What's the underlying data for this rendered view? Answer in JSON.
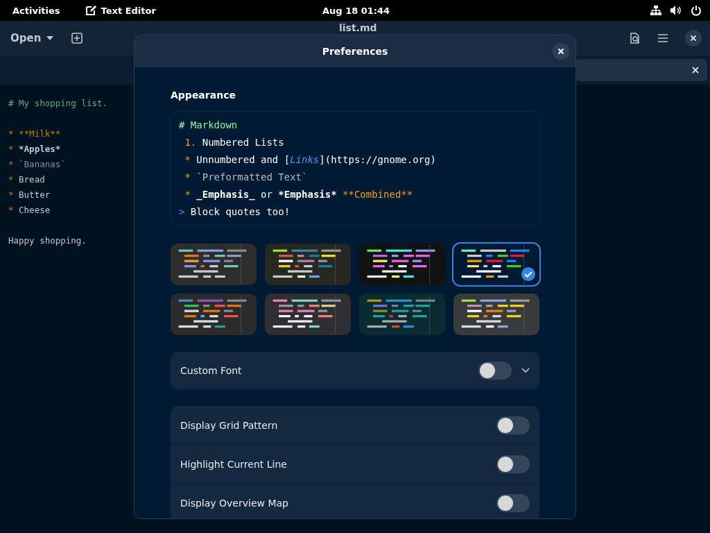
{
  "top_bar": {
    "activities": "Activities",
    "app_name": "Text Editor",
    "clock": "Aug 18  01:44"
  },
  "header": {
    "open_label": "Open",
    "title": "list.md"
  },
  "editor": {
    "paragraphs": [
      {
        "lines": [
          {
            "segments": [
              {
                "kind": "heading",
                "text": "# My shopping list."
              }
            ]
          }
        ]
      },
      {
        "lines": [
          {
            "segments": [
              {
                "kind": "marker",
                "text": "* "
              },
              {
                "kind": "strong",
                "text": "**Milk**"
              }
            ]
          },
          {
            "segments": [
              {
                "kind": "marker",
                "text": "* "
              },
              {
                "kind": "bold",
                "text": "*Apples*"
              }
            ]
          },
          {
            "segments": [
              {
                "kind": "marker",
                "text": "* "
              },
              {
                "kind": "code",
                "text": "`Bananas`"
              }
            ]
          },
          {
            "segments": [
              {
                "kind": "marker",
                "text": "* "
              },
              {
                "kind": "plain",
                "text": "Bread"
              }
            ]
          },
          {
            "segments": [
              {
                "kind": "marker",
                "text": "* "
              },
              {
                "kind": "plain",
                "text": "Butter"
              }
            ]
          },
          {
            "segments": [
              {
                "kind": "marker",
                "text": "* "
              },
              {
                "kind": "plain",
                "text": "Cheese"
              }
            ]
          }
        ]
      },
      {
        "lines": [
          {
            "segments": [
              {
                "kind": "plain",
                "text": "Happy shopping."
              }
            ]
          }
        ]
      }
    ]
  },
  "dialog": {
    "title": "Preferences",
    "section": "Appearance",
    "preview": [
      {
        "segments": [
          {
            "kind": "heading",
            "text": "# Markdown"
          }
        ]
      },
      {
        "segments": [
          {
            "kind": "marker",
            "text": " 1. "
          },
          {
            "kind": "plain",
            "text": "Numbered Lists"
          }
        ]
      },
      {
        "segments": [
          {
            "kind": "marker",
            "text": " * "
          },
          {
            "kind": "plain",
            "text": "Unnumbered and ["
          },
          {
            "kind": "link",
            "text": "Links"
          },
          {
            "kind": "plain",
            "text": "](https://gnome.org)"
          }
        ]
      },
      {
        "segments": [
          {
            "kind": "marker",
            "text": " * "
          },
          {
            "kind": "code",
            "text": "`Preformatted Text`"
          }
        ]
      },
      {
        "segments": [
          {
            "kind": "marker",
            "text": " * "
          },
          {
            "kind": "bold",
            "text": "_Emphasis_"
          },
          {
            "kind": "plain",
            "text": " or "
          },
          {
            "kind": "bold",
            "text": "*Emphasis*"
          },
          {
            "kind": "strong",
            "text": " **Combined**"
          }
        ]
      },
      {
        "segments": [
          {
            "kind": "quote",
            "text": "> "
          },
          {
            "kind": "plain",
            "text": "Block quotes too!"
          }
        ]
      }
    ],
    "schemes": [
      {
        "color": "#2d2d2d",
        "selected": false
      },
      {
        "color": "#272822",
        "selected": false
      },
      {
        "color": "#121212",
        "selected": false
      },
      {
        "color": "#001a33",
        "selected": true
      },
      {
        "color": "#2b2b2b",
        "selected": false
      },
      {
        "color": "#2f2f33",
        "selected": false
      },
      {
        "color": "#0b2b33",
        "selected": false
      },
      {
        "color": "#383a3b",
        "selected": false
      }
    ],
    "custom_font": {
      "label": "Custom Font",
      "on": false,
      "expanded": false
    },
    "toggles": [
      {
        "label": "Display Grid Pattern",
        "on": false
      },
      {
        "label": "Highlight Current Line",
        "on": false
      },
      {
        "label": "Display Overview Map",
        "on": false
      }
    ]
  }
}
